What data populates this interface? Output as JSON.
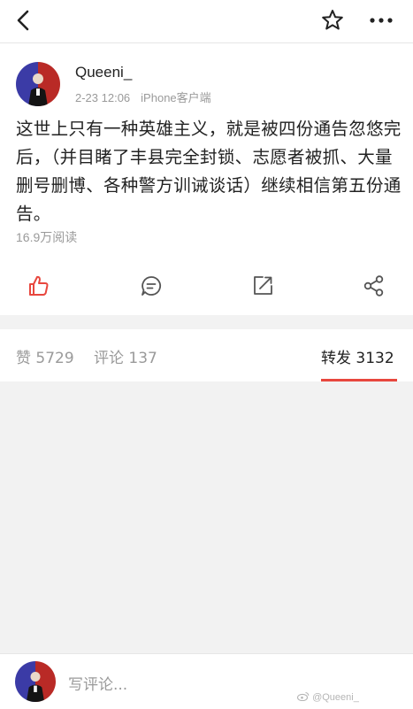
{
  "post": {
    "username": "Queeni_",
    "time": "2-23 12:06",
    "source": "iPhone客户端",
    "content": "这世上只有一种英雄主义，就是被四份通告忽悠完后，（并目睹了丰县完全封锁、志愿者被抓、大量删号删博、各种警方训诫谈话）继续相信第五份通告。",
    "reads": "16.9万阅读"
  },
  "tabs": {
    "likes": "赞 5729",
    "comments": "评论 137",
    "reposts": "转发 3132"
  },
  "footer": {
    "comment_placeholder": "写评论...",
    "watermark": "@Queeni_"
  },
  "icons": {
    "top": [
      "back-arrow",
      "star",
      "more-dots"
    ],
    "actions": [
      "like-thumb",
      "comment-bubble",
      "repost-arrow",
      "share-nodes"
    ]
  },
  "colors": {
    "accent": "#e8473e",
    "avatar_left": "#3b3ba6",
    "avatar_right": "#b92a26"
  }
}
